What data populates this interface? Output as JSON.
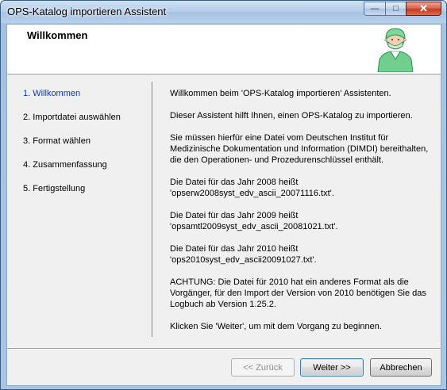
{
  "window": {
    "title": "OPS-Katalog importieren Assistent",
    "controls": {
      "minimize": "—",
      "maximize": "□",
      "close": "✕"
    }
  },
  "header": {
    "title": "Willkommen",
    "art_icon": "surgeon-icon"
  },
  "steps": [
    {
      "label": "1. Willkommen",
      "active": true
    },
    {
      "label": "2. Importdatei auswählen",
      "active": false
    },
    {
      "label": "3. Format wählen",
      "active": false
    },
    {
      "label": "4. Zusammenfassung",
      "active": false
    },
    {
      "label": "5. Fertigstellung",
      "active": false
    }
  ],
  "content": {
    "paragraphs": [
      "Willkommen beim 'OPS-Katalog importieren' Assistenten.",
      "Dieser Assistent hilft Ihnen, einen OPS-Katalog zu importieren.",
      "Sie müssen hierfür eine Datei vom Deutschen Institut für\nMedizinische Dokumentation und Information (DIMDI) bereithalten,\ndie den Operationen- und Prozedurenschlüssel enthält.",
      "Die Datei für das Jahr 2008 heißt\n'opserw2008syst_edv_ascii_20071116.txt'.",
      "Die Datei für das Jahr 2009 heißt\n'opsamtl2009syst_edv_ascii_20081021.txt'.",
      "Die Datei für das Jahr 2010 heißt\n'ops2010syst_edv_ascii20091027.txt'.",
      "ACHTUNG: Die Datei für 2010 hat ein anderes Format als die\nVorgänger, für den Import der Version von 2010 benötigen Sie das\nLogbuch ab Version 1.25.2.",
      "Klicken Sie 'Weiter', um mit dem Vorgang zu beginnen."
    ]
  },
  "buttons": {
    "back": "<< Zurück",
    "next": "Weiter >>",
    "cancel": "Abbrechen"
  },
  "colors": {
    "active_step": "#0a3ab8",
    "disabled_text": "#8d8d8d",
    "title_bar": "#b4cce8"
  }
}
